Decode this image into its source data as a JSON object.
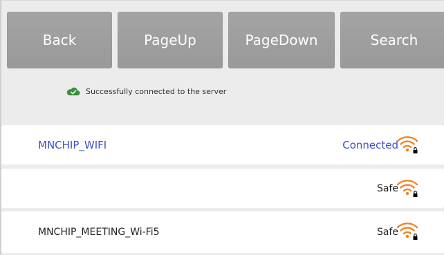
{
  "toolbar": {
    "back_label": "Back",
    "pageup_label": "PageUp",
    "pagedown_label": "PageDown",
    "search_label": "Search"
  },
  "status": {
    "message": "Successfully connected to the server",
    "icon": "cloud-check-icon",
    "color": "#3a8f3a"
  },
  "wifi_list": [
    {
      "ssid": "MNCHIP_WIFI",
      "state": "Connected",
      "icon": "wifi-locked-icon"
    },
    {
      "ssid": "",
      "state": "Safe",
      "icon": "wifi-locked-icon"
    },
    {
      "ssid": "MNCHIP_MEETING_Wi-Fi5",
      "state": "Safe",
      "icon": "wifi-locked-icon"
    }
  ],
  "colors": {
    "accent": "#3d4fc9",
    "wifi_orange": "#f58220",
    "button_bg": "#a0a0a0"
  }
}
